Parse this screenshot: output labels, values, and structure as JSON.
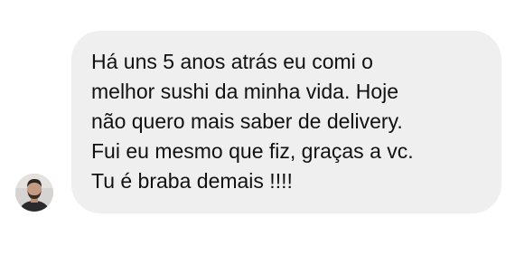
{
  "conversation": {
    "incoming_message": {
      "sender_avatar": "user-avatar-photo",
      "lines": [
        "Há uns 5 anos atrás eu comi o",
        "melhor sushi da minha vida. Hoje",
        "não quero mais saber de delivery.",
        "Fui eu mesmo que fiz, graças a vc.",
        "Tu é braba demais !!!!"
      ],
      "bubble_color": "#efefef",
      "text_color": "#111111"
    }
  }
}
